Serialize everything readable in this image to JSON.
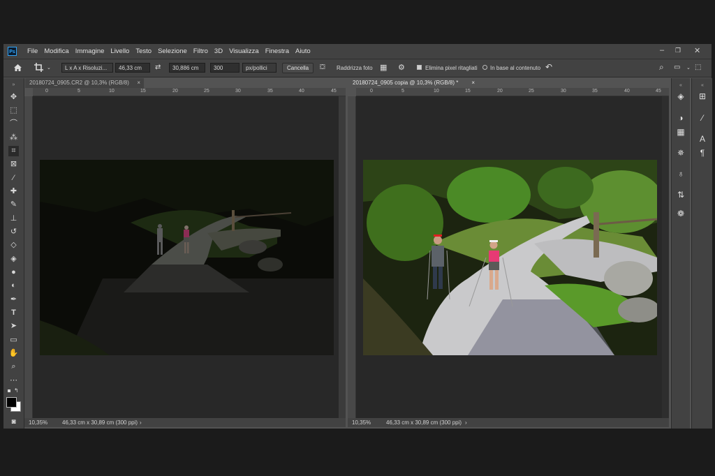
{
  "menubar": {
    "items": [
      "File",
      "Modifica",
      "Immagine",
      "Livello",
      "Testo",
      "Selezione",
      "Filtro",
      "3D",
      "Visualizza",
      "Finestra",
      "Aiuto"
    ],
    "app_icon": "Ps"
  },
  "options": {
    "ratio_dropdown": "L x A x Risoluzi...",
    "width": "46,33 cm",
    "height": "30,886 cm",
    "resolution": "300",
    "unit": "px/pollici",
    "cancel": "Cancella",
    "straighten": "Raddrizza foto",
    "delete_cropped": "Elimina pixel ritagliati",
    "content_aware": "In base al contenuto"
  },
  "tabs": {
    "left": "20180724_0905.CR2 @ 10,3% (RGB/8)",
    "right": "20180724_0905 copia @ 10,3% (RGB/8) *",
    "close": "×"
  },
  "rulers": {
    "h_ticks": [
      "0",
      "5",
      "10",
      "15",
      "20",
      "25",
      "30",
      "35",
      "40",
      "45"
    ],
    "v_ticks": [
      "5",
      "0",
      "5",
      "10",
      "15",
      "20",
      "25",
      "30",
      "35"
    ]
  },
  "status": {
    "left_zoom": "10,35%",
    "left_info": "46,33 cm x 30,89 cm (300 ppi)",
    "right_zoom": "10,35%",
    "right_info": "46,33 cm x 30,89 cm (300 ppi)",
    "arrow": "›"
  },
  "colors": {
    "accent": "#31a8ff",
    "ui_bg": "#535353",
    "panel": "#424242",
    "canvas": "#282828"
  }
}
